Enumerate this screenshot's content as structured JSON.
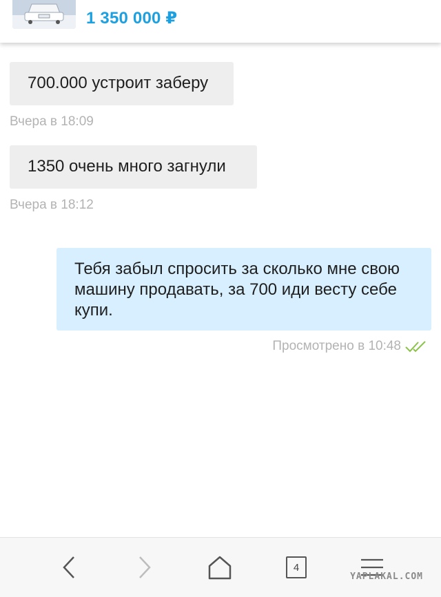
{
  "listing": {
    "price": "1 350 000 ₽",
    "thumb_icon": "car-photo"
  },
  "messages": [
    {
      "direction": "incoming",
      "text": "700.000 устроит заберу",
      "time": "Вчера в 18:09"
    },
    {
      "direction": "incoming",
      "text": "1350 очень много загнули",
      "time": "Вчера в 18:12"
    },
    {
      "direction": "outgoing",
      "text": "Тебя забыл спросить за сколько мне свою машину продавать, за 700 иди весту себе купи.",
      "status": "Просмотрено в 10:48"
    }
  ],
  "bottom_nav": {
    "back_icon": "chevron-left-icon",
    "forward_icon": "chevron-right-icon",
    "home_icon": "home-icon",
    "tabs_count": "4",
    "menu_icon": "menu-icon"
  },
  "watermark": "YAPLAKAL.COM",
  "colors": {
    "price": "#1ca0e0",
    "incoming_bubble": "#eeeeee",
    "outgoing_bubble": "#d7efff",
    "seen_check": "#8bc34a",
    "meta_text": "#b3b3b3"
  }
}
